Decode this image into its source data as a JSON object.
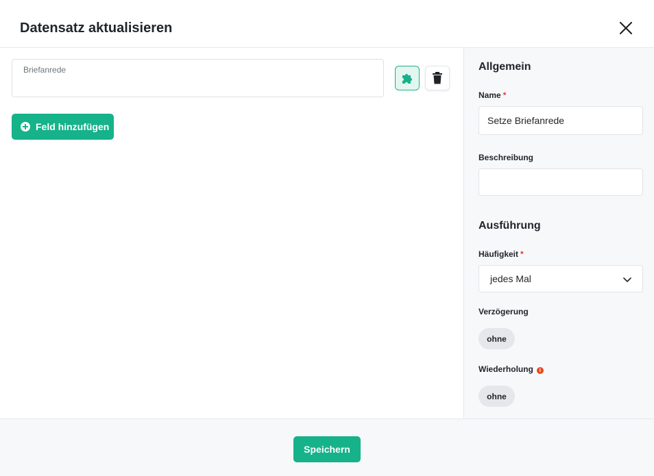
{
  "header": {
    "title": "Datensatz aktualisieren",
    "close_icon": "close-icon"
  },
  "fields": [
    {
      "label": "Briefanrede",
      "value": ""
    }
  ],
  "field_actions": {
    "puzzle_icon": "puzzle-icon",
    "trash_icon": "trash-icon"
  },
  "add_field_label": "Feld hinzufügen",
  "side": {
    "general_title": "Allgemein",
    "name_label": "Name",
    "name_required": "*",
    "name_value": "Setze Briefanrede",
    "description_label": "Beschreibung",
    "description_value": "",
    "execution_title": "Ausführung",
    "frequency_label": "Häufigkeit",
    "frequency_required": "*",
    "frequency_value": "jedes Mal",
    "delay_label": "Verzögerung",
    "delay_value": "ohne",
    "repeat_label": "Wiederholung",
    "repeat_info": "i",
    "repeat_value": "ohne"
  },
  "footer": {
    "save_label": "Speichern"
  },
  "colors": {
    "accent": "#16b28a",
    "required": "#e53935",
    "info": "#e8491d"
  }
}
